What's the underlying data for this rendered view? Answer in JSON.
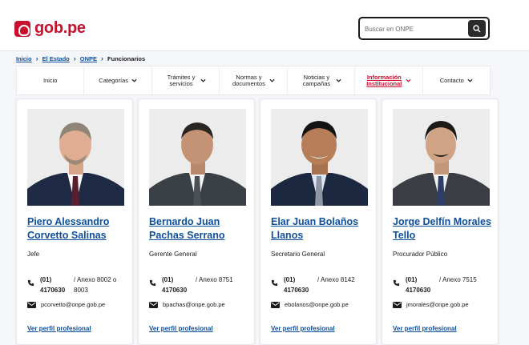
{
  "header": {
    "logo_text": "gob.pe",
    "search_placeholder": "Buscar en ONPE",
    "brand_color": "#c8102e",
    "link_color": "#0e4f9b"
  },
  "breadcrumb": {
    "items": [
      "Inicio",
      "El Estado",
      "ONPE"
    ],
    "current": "Funcionarios"
  },
  "nav": {
    "items": [
      {
        "label": "Inicio",
        "has_dropdown": false
      },
      {
        "label": "Categorías",
        "has_dropdown": true
      },
      {
        "label": "Trámites y servicios",
        "has_dropdown": true
      },
      {
        "label": "Normas y documentos",
        "has_dropdown": true
      },
      {
        "label": "Noticias y campañas",
        "has_dropdown": true
      },
      {
        "label": "Información Institucional",
        "has_dropdown": true,
        "active": true
      },
      {
        "label": "Contacto",
        "has_dropdown": true
      }
    ]
  },
  "officials": [
    {
      "name": "Piero Alessandro Corvetto Salinas",
      "role": "Jefe",
      "phone": "(01) 4170630",
      "extension": "/ Anexo 8002 o 8003",
      "email": "pcorvetto@onpe.gob.pe",
      "profile_link": "Ver perfil profesional"
    },
    {
      "name": "Bernardo Juan Pachas Serrano",
      "role": "Gerente General",
      "phone": "(01) 4170630",
      "extension": "/ Anexo 8751",
      "email": "bpachas@onpe.gob.pe",
      "profile_link": "Ver perfil profesional"
    },
    {
      "name": "Elar Juan Bolaños Llanos",
      "role": "Secretario General",
      "phone": "(01) 4170630",
      "extension": "/ Anexo 8142",
      "email": "ebolanos@onpe.gob.pe",
      "profile_link": "Ver perfil profesional"
    },
    {
      "name": "Jorge Delfín Morales Tello",
      "role": "Procurador Público",
      "phone": "(01) 4170630",
      "extension": "/ Anexo 7515",
      "email": "jmorales@onpe.gob.pe",
      "profile_link": "Ver perfil profesional"
    }
  ]
}
